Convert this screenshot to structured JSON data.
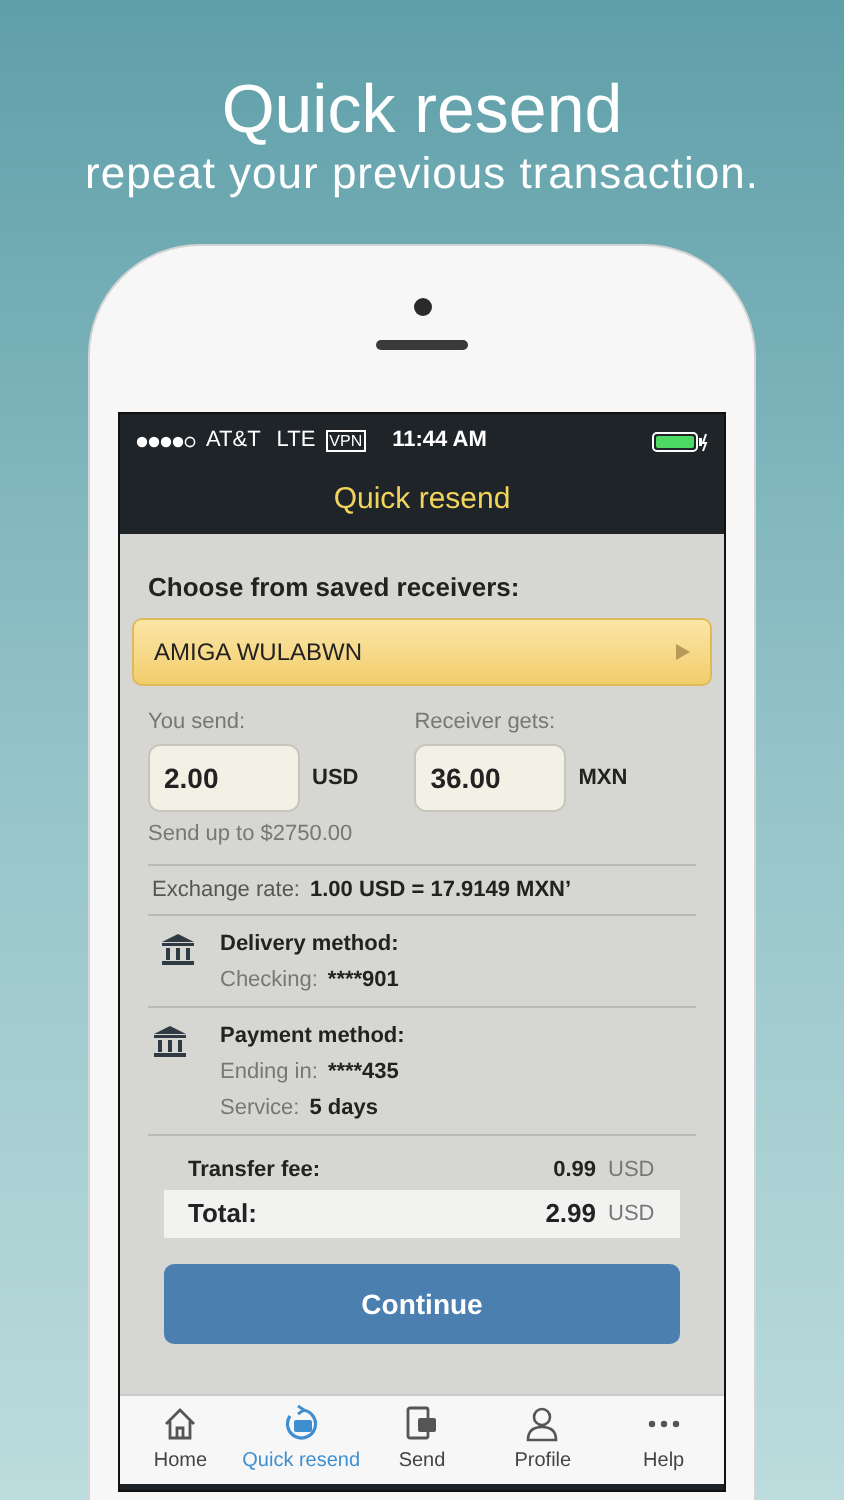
{
  "headline": {
    "title": "Quick resend",
    "subtitle": "repeat your previous transaction."
  },
  "status_bar": {
    "carrier": "AT&T",
    "network": "LTE",
    "vpn": "VPN",
    "time": "11:44 AM"
  },
  "nav_bar": {
    "title": "Quick resend"
  },
  "receivers": {
    "label": "Choose from saved receivers:",
    "selected_receiver": "AMIGA WULABWN"
  },
  "amounts": [
    {
      "label": "You send:",
      "value": "2.00",
      "currency": "USD"
    },
    {
      "label": "Receiver gets:",
      "value": "36.00",
      "currency": "MXN"
    }
  ],
  "send_limit": "Send up to $2750.00",
  "exchange_rate": {
    "label": "Exchange rate:",
    "value": "1.00 USD = 17.9149 MXN’"
  },
  "methods": [
    {
      "title": "Delivery method:",
      "details": [
        {
          "label": "Checking:",
          "value": "****901"
        }
      ]
    },
    {
      "title": "Payment method:",
      "details": [
        {
          "label": "Ending in:",
          "value": "****435"
        },
        {
          "label": "Service:",
          "value": "5 days"
        }
      ]
    }
  ],
  "fees": [
    {
      "kind": "fee",
      "label": "Transfer fee:",
      "amount": "0.99",
      "currency": "USD"
    },
    {
      "kind": "total",
      "label": "Total:",
      "amount": "2.99",
      "currency": "USD"
    }
  ],
  "continue_button": "Continue",
  "tab_bar": [
    {
      "label": "Home",
      "selected": false
    },
    {
      "label": "Quick resend",
      "selected": true
    },
    {
      "label": "Send",
      "selected": false
    },
    {
      "label": "Profile",
      "selected": false
    },
    {
      "label": "Help",
      "selected": false
    }
  ]
}
